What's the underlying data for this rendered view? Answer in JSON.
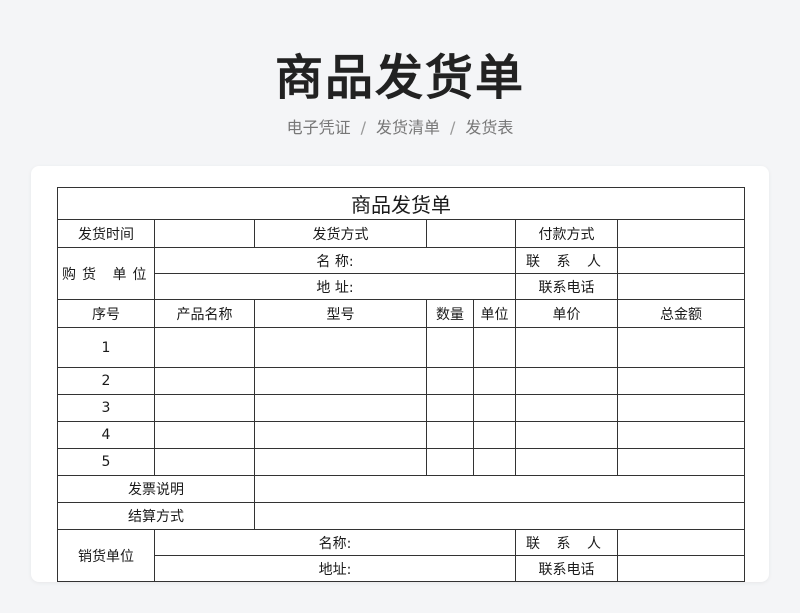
{
  "header": {
    "title": "商品发货单",
    "breadcrumb": [
      "电子凭证",
      "发货清单",
      "发货表"
    ],
    "separator": "/"
  },
  "form": {
    "title": "商品发货单",
    "ship_time_label": "发货时间",
    "ship_method_label": "发货方式",
    "payment_method_label": "付款方式",
    "buyer_label": "购货 单位",
    "buyer_name_label": "名 称:",
    "buyer_address_label": "地 址:",
    "contact_label": "联 系 人",
    "phone_label": "联系电话",
    "columns": [
      "序号",
      "产品名称",
      "型号",
      "数量",
      "单位",
      "单价",
      "总金额"
    ],
    "rows": [
      "1",
      "2",
      "3",
      "4",
      "5"
    ],
    "invoice_label": "发票说明",
    "settlement_label": "结算方式",
    "seller_label": "销货单位",
    "seller_name_label": "名称:",
    "seller_address_label": "地址:",
    "seller_contact_label": "联 系 人",
    "seller_phone_label": "联系电话"
  }
}
